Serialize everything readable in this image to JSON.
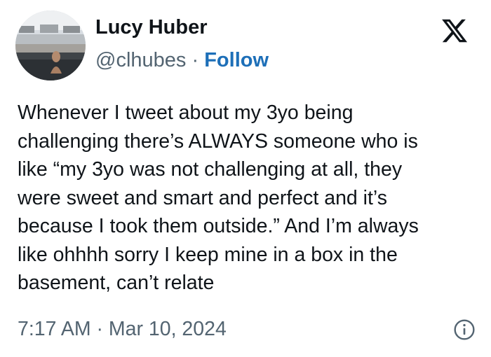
{
  "tweet": {
    "author": {
      "display_name": "Lucy Huber",
      "handle": "@clhubes",
      "separator": "·",
      "follow_label": "Follow"
    },
    "text_lines": [
      "Whenever I tweet about my 3yo being",
      "challenging there’s ALWAYS someone who is",
      "like “my 3yo was not challenging at all, they",
      "were sweet and smart and perfect and it’s",
      "because I took them outside.” And I’m always",
      "like ohhhh sorry I keep mine in a box in the",
      "basement, can’t relate"
    ],
    "timestamp": "7:17 AM · Mar 10, 2024"
  },
  "icons": {
    "brand": "x-logo-icon",
    "info": "info-icon"
  },
  "colors": {
    "text": "#0f1419",
    "secondary": "#536471",
    "follow": "#1d6fb8",
    "background": "#ffffff"
  }
}
